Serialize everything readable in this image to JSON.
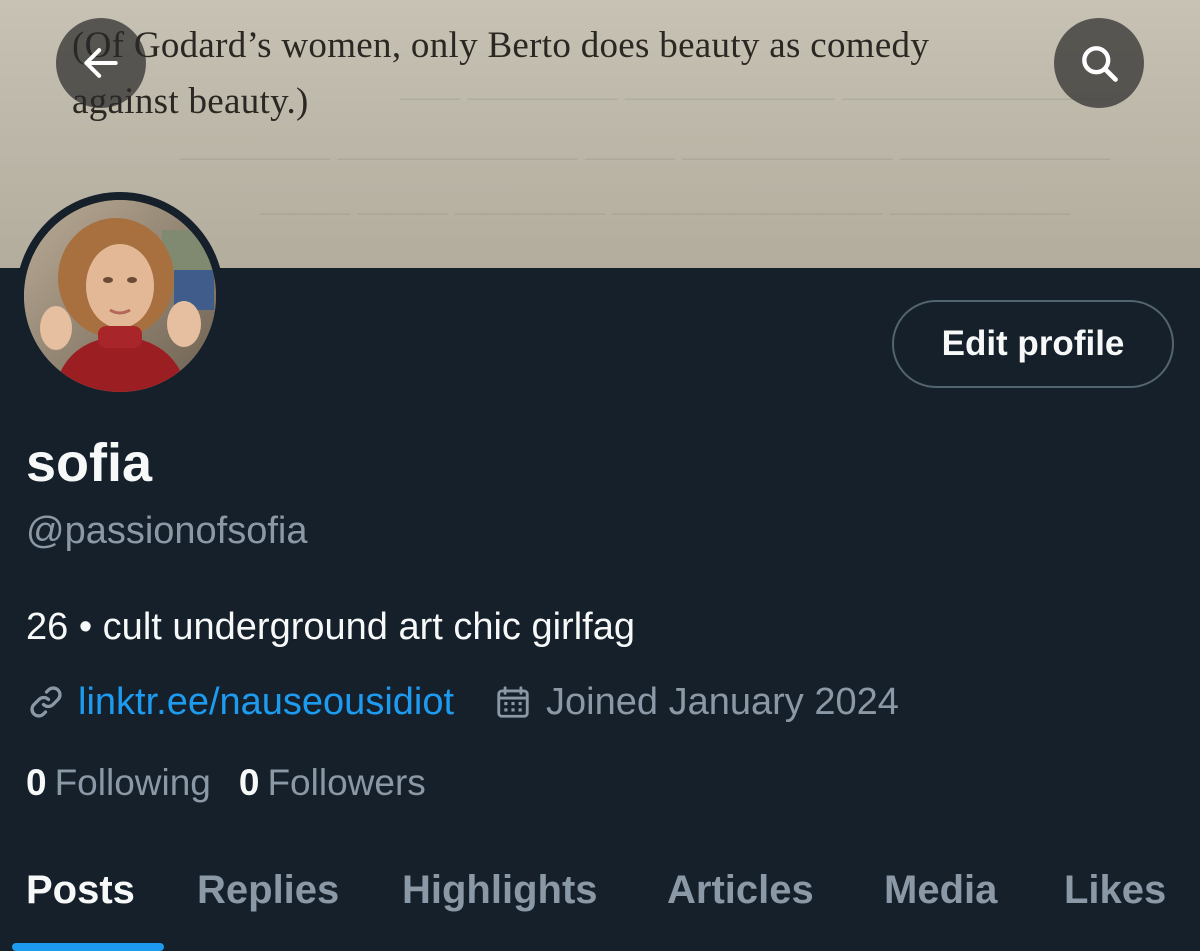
{
  "banner": {
    "line1": "(Of Godard’s women, only Berto does beauty as comedy",
    "line2": "against beauty.)"
  },
  "nav": {
    "back_icon": "arrow-left-icon",
    "search_icon": "search-icon"
  },
  "profile": {
    "edit_label": "Edit profile",
    "name": "sofia",
    "handle": "@passionofsofia",
    "bio": "26 • cult underground art chic girlfag",
    "link": "linktr.ee/nauseousidiot",
    "joined": "Joined January 2024",
    "following_count": "0",
    "following_label": "Following",
    "followers_count": "0",
    "followers_label": "Followers"
  },
  "tabs": [
    {
      "label": "Posts"
    },
    {
      "label": "Replies"
    },
    {
      "label": "Highlights"
    },
    {
      "label": "Articles"
    },
    {
      "label": "Media"
    },
    {
      "label": "Likes"
    }
  ],
  "colors": {
    "background": "#15202b",
    "accent": "#1d9bf0",
    "secondary_text": "#8b98a5",
    "primary_text": "#f7f9f9"
  }
}
